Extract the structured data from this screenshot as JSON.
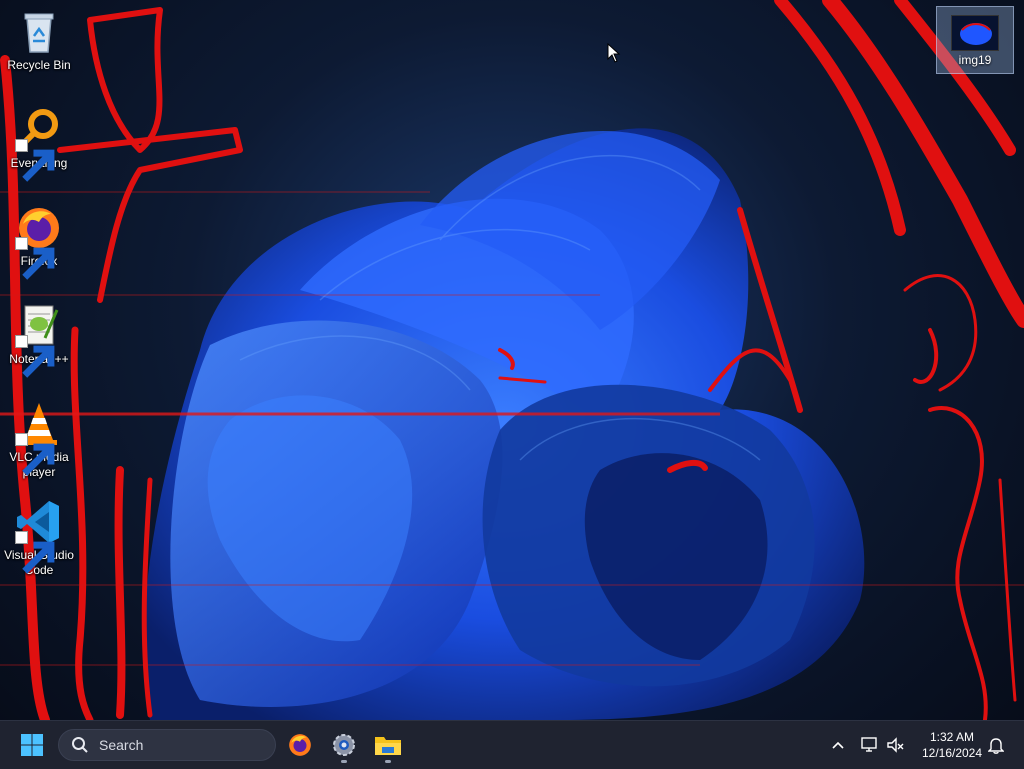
{
  "desktop": {
    "icons": [
      {
        "label": "Recycle Bin",
        "icon": "recycle-bin-icon"
      },
      {
        "label": "Everything",
        "icon": "everything-icon"
      },
      {
        "label": "Firefox",
        "icon": "firefox-icon"
      },
      {
        "label": "Notepad++",
        "icon": "notepad-plus-plus-icon"
      },
      {
        "label": "VLC media player",
        "icon": "vlc-icon"
      },
      {
        "label": "Visual Studio Code",
        "icon": "vscode-icon"
      }
    ],
    "image_file": {
      "label": "img19",
      "icon": "image-file-icon"
    }
  },
  "taskbar": {
    "start_icon": "windows-start-icon",
    "search_placeholder": "Search",
    "pinned": [
      {
        "name": "Firefox",
        "icon": "firefox-icon",
        "running": false
      },
      {
        "name": "Settings",
        "icon": "settings-gear-icon",
        "running": true
      },
      {
        "name": "File Explorer",
        "icon": "file-explorer-icon",
        "running": true
      }
    ],
    "tray": {
      "icons": [
        "chevron-up-icon",
        "network-icon",
        "volume-muted-icon",
        "notification-bell-icon"
      ],
      "time": "1:32 AM",
      "date": "12/16/2024"
    }
  },
  "colors": {
    "taskbar_bg": "#1f2330",
    "wallpaper_blue": "#1f56ff",
    "annotation_red": "#e01010"
  }
}
